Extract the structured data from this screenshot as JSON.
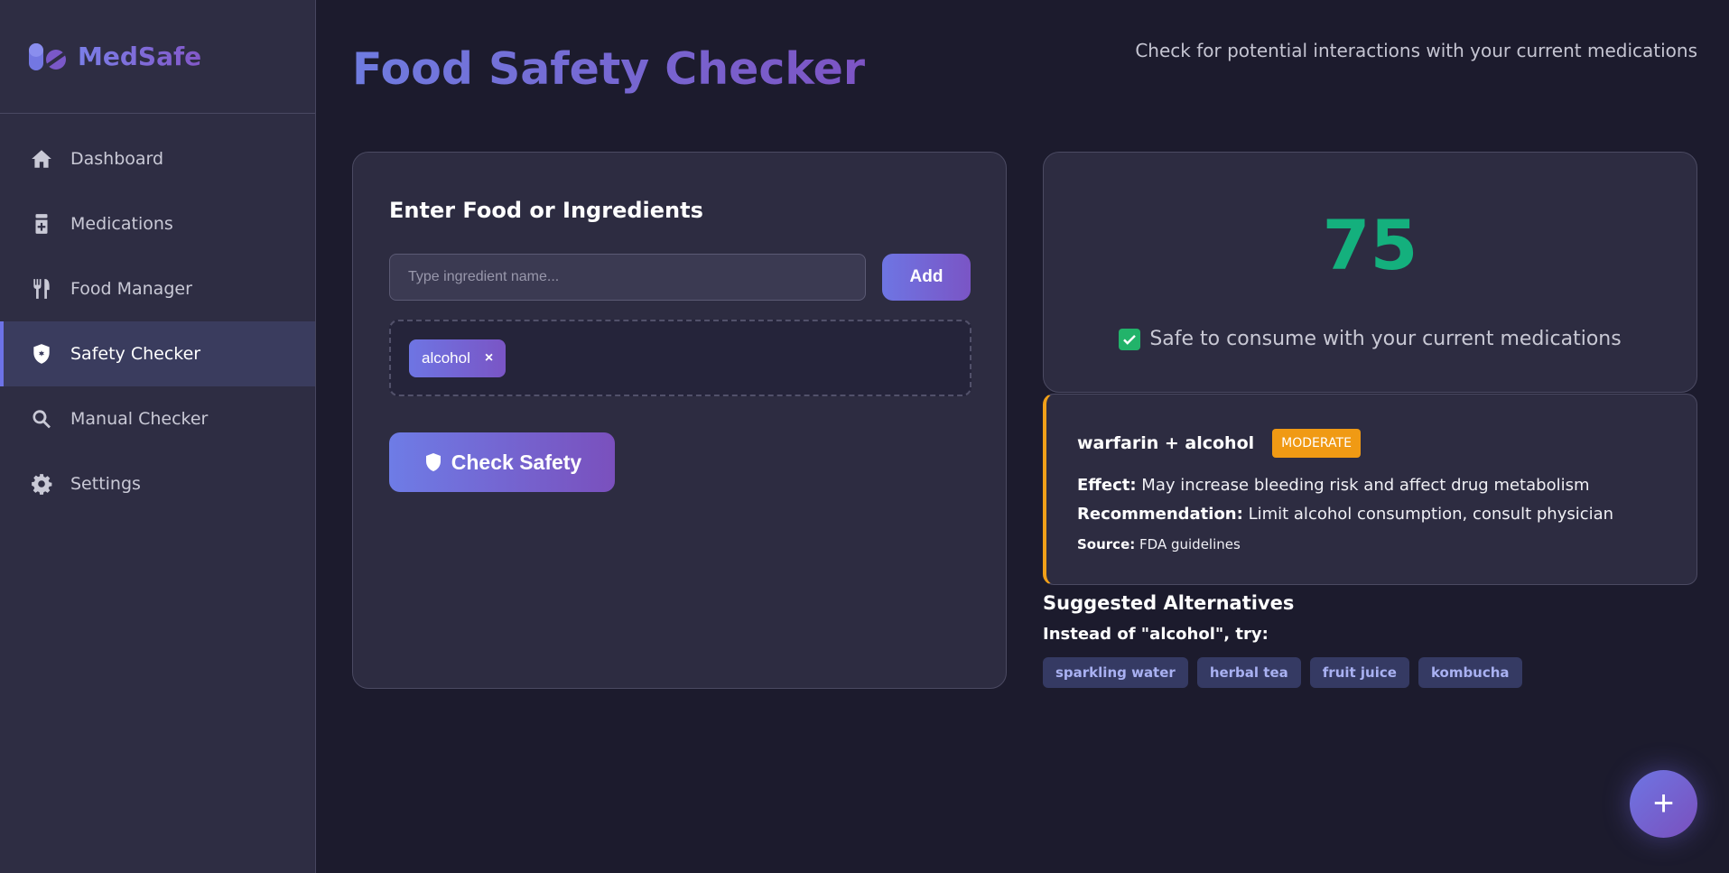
{
  "app": {
    "name": "MedSafe"
  },
  "sidebar": {
    "items": [
      {
        "label": "Dashboard",
        "icon": "home-icon"
      },
      {
        "label": "Medications",
        "icon": "pill-bottle-icon"
      },
      {
        "label": "Food Manager",
        "icon": "utensils-icon"
      },
      {
        "label": "Safety Checker",
        "icon": "shield-icon",
        "active": true
      },
      {
        "label": "Manual Checker",
        "icon": "search-icon"
      },
      {
        "label": "Settings",
        "icon": "gear-icon"
      }
    ]
  },
  "header": {
    "title": "Food Safety Checker",
    "subtitle": "Check for potential interactions with your current medications"
  },
  "input_panel": {
    "heading": "Enter Food or Ingredients",
    "placeholder": "Type ingredient name...",
    "add_label": "Add",
    "tags": [
      {
        "label": "alcohol",
        "remove": "×"
      }
    ],
    "check_label": "Check Safety"
  },
  "score": {
    "value": "75",
    "status": "Safe to consume with your current medications",
    "color": "#14b07d"
  },
  "interaction": {
    "title": "warfarin + alcohol",
    "severity": "MODERATE",
    "severity_color": "#f09a14",
    "effect_label": "Effect:",
    "effect": "May increase bleeding risk and affect drug metabolism",
    "recommendation_label": "Recommendation:",
    "recommendation": "Limit alcohol consumption, consult physician",
    "source_label": "Source:",
    "source": "FDA guidelines"
  },
  "alternatives": {
    "heading": "Suggested Alternatives",
    "subheading": "Instead of \"alcohol\", try:",
    "items": [
      "sparkling water",
      "herbal tea",
      "fruit juice",
      "kombucha"
    ]
  },
  "fab": {
    "label": "+"
  }
}
